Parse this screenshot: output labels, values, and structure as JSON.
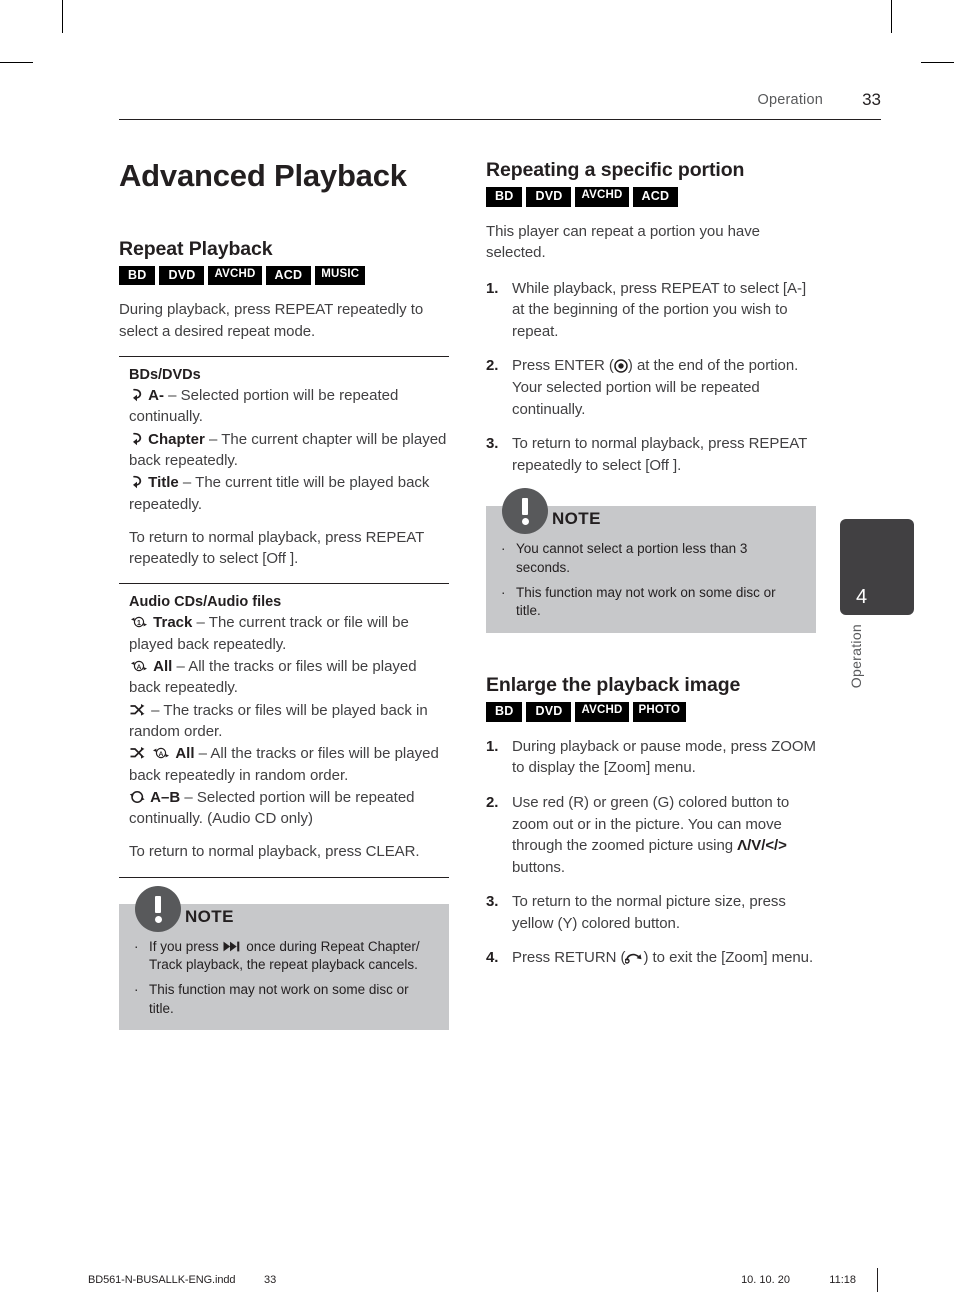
{
  "header": {
    "section": "Operation",
    "page_number": "33"
  },
  "left": {
    "title": "Advanced Playback",
    "repeat": {
      "heading": "Repeat Playback",
      "badges": [
        "BD",
        "DVD",
        "AVCHD",
        "ACD",
        "MUSIC"
      ],
      "intro": "During playback, press REPEAT repeatedly to select a desired repeat mode.",
      "bd_dvd": {
        "heading": "BDs/DVDs",
        "items": [
          {
            "label": "A-",
            "text": " – Selected portion will be repeated continually.",
            "icon": "repeat-ab-icon"
          },
          {
            "label": "Chapter",
            "text": " – The current chapter will be played back repeatedly.",
            "icon": "repeat-chapter-icon"
          },
          {
            "label": "Title",
            "text": " – The current title will be played back repeatedly.",
            "icon": "repeat-title-icon"
          }
        ],
        "outro": "To return to normal playback, press REPEAT repeatedly to select [Off ]."
      },
      "audio": {
        "heading": "Audio CDs/Audio files",
        "items": [
          {
            "label": "Track",
            "text": " – The current track or file will be played back repeatedly.",
            "icon": "repeat-one-icon"
          },
          {
            "label": "All",
            "text": " – All the tracks or files will be played back repeatedly.",
            "icon": "repeat-all-icon"
          },
          {
            "label": "",
            "text": "– The tracks or files will be played back in random order.",
            "icon": "shuffle-icon"
          },
          {
            "label": "All",
            "text": " – All the tracks or files will be played back repeatedly in random order.",
            "icon": "shuffle-repeat-all-icon"
          },
          {
            "label": "A–B",
            "text": " – Selected portion will be repeated continually. (Audio CD only)",
            "icon": "repeat-ab-circle-icon"
          }
        ],
        "outro": "To return to normal playback, press CLEAR."
      },
      "note": {
        "title": "NOTE",
        "items": [
          {
            "pre": "If you press ",
            "glyph": "skip-forward-icon",
            "post": " once during Repeat Chapter/ Track playback, the repeat playback cancels."
          },
          {
            "pre": "This function may not work on some disc or title.",
            "glyph": "",
            "post": ""
          }
        ]
      }
    }
  },
  "right": {
    "repeating_portion": {
      "heading": "Repeating a specific portion",
      "badges": [
        "BD",
        "DVD",
        "AVCHD",
        "ACD"
      ],
      "intro": "This player can repeat a portion you have selected.",
      "steps": [
        {
          "num": "1.",
          "pre": "While playback, press REPEAT to select [A-] at the beginning of the portion you wish to repeat.",
          "glyph": "",
          "post": ""
        },
        {
          "num": "2.",
          "pre": "Press ENTER (",
          "glyph": "enter-icon",
          "post": ") at the end of the portion. Your selected portion will be repeated continually."
        },
        {
          "num": "3.",
          "pre": "To return to normal playback, press REPEAT repeatedly to select [Off ].",
          "glyph": "",
          "post": ""
        }
      ],
      "note": {
        "title": "NOTE",
        "items": [
          "You cannot select a portion less than 3 seconds.",
          "This function may not work on some disc or title."
        ]
      }
    },
    "enlarge": {
      "heading": "Enlarge the playback image",
      "badges": [
        "BD",
        "DVD",
        "AVCHD",
        "PHOTO"
      ],
      "steps": [
        {
          "num": "1.",
          "pre": "During playback or pause mode, press ZOOM to display the [Zoom] menu.",
          "glyph": "",
          "post": ""
        },
        {
          "num": "2.",
          "pre": "Use red (R) or green (G) colored button to zoom out or in the picture. You can move through the zoomed picture using ",
          "glyph": "arrow-keys",
          "post": " buttons.",
          "arrows": "Λ/V/</>"
        },
        {
          "num": "3.",
          "pre": "To return to the normal picture size, press yellow (Y) colored button.",
          "glyph": "",
          "post": ""
        },
        {
          "num": "4.",
          "pre": " Press RETURN (",
          "glyph": "return-icon",
          "post": ") to exit the [Zoom] menu."
        }
      ]
    }
  },
  "side_tab": {
    "number": "4",
    "label": "Operation"
  },
  "footer": {
    "filename": "BD561-N-BUSALLK-ENG.indd",
    "page": "33",
    "date": "10. 10. 20",
    "time": "11:18"
  },
  "colors": {
    "badge_bg": "#000000",
    "note_bg": "#c7c8ca",
    "bubble": "#58595b",
    "tab": "#414042",
    "body_text": "#414042"
  }
}
